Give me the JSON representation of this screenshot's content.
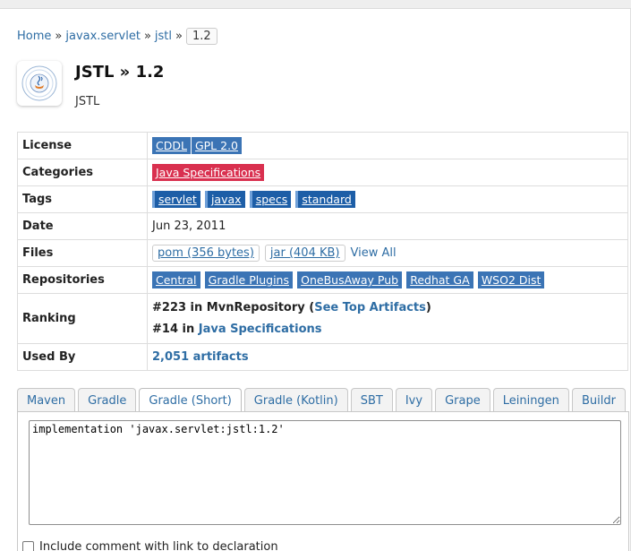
{
  "breadcrumb": {
    "home": "Home",
    "group": "javax.servlet",
    "artifact": "jstl",
    "version": "1.2",
    "separator": "»"
  },
  "header": {
    "title": "JSTL » 1.2",
    "subtitle": "JSTL",
    "logo_icon": "java-community-process-logo"
  },
  "info": {
    "license": {
      "label": "License",
      "badges": [
        "CDDL",
        "GPL 2.0"
      ]
    },
    "categories": {
      "label": "Categories",
      "badges": [
        "Java Specifications"
      ]
    },
    "tags": {
      "label": "Tags",
      "badges": [
        "servlet",
        "javax",
        "specs",
        "standard"
      ]
    },
    "date": {
      "label": "Date",
      "value": "Jun 23, 2011"
    },
    "files": {
      "label": "Files",
      "pom": "pom (356 bytes)",
      "jar": "jar (404 KB)",
      "view_all": "View All"
    },
    "repositories": {
      "label": "Repositories",
      "badges": [
        "Central",
        "Gradle Plugins",
        "OneBusAway Pub",
        "Redhat GA",
        "WSO2 Dist"
      ]
    },
    "ranking": {
      "label": "Ranking",
      "line1_prefix": "#223 in MvnRepository (",
      "line1_link": "See Top Artifacts",
      "line1_suffix": ")",
      "line2_prefix": "#14 in ",
      "line2_link": "Java Specifications"
    },
    "used_by": {
      "label": "Used By",
      "value": "2,051 artifacts"
    }
  },
  "tabs": [
    "Maven",
    "Gradle",
    "Gradle (Short)",
    "Gradle (Kotlin)",
    "SBT",
    "Ivy",
    "Grape",
    "Leiningen",
    "Buildr"
  ],
  "active_tab": "Gradle (Short)",
  "snippet": "implementation 'javax.servlet:jstl:1.2'",
  "include_comment_label": "Include comment with link to declaration",
  "colors": {
    "link": "#2e6da4",
    "badge_blue": "#3b74b5",
    "badge_red": "#d9304f",
    "tag_blue": "#1d5ea7"
  }
}
